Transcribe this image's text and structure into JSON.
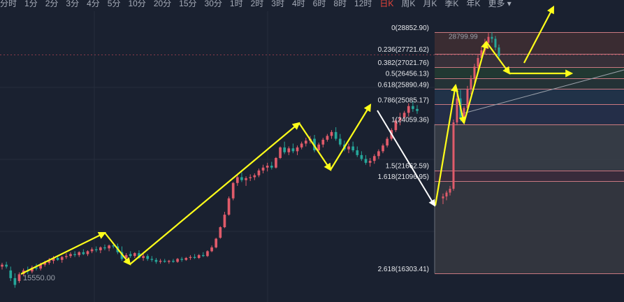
{
  "toolbar": {
    "timeframes": [
      "分时",
      "1分",
      "2分",
      "3分",
      "4分",
      "5分",
      "10分",
      "20分",
      "15分",
      "30分",
      "1时",
      "2时",
      "3时",
      "4时",
      "6时",
      "8时",
      "12时",
      "日K",
      "周K",
      "月K",
      "季K",
      "年K",
      "更多"
    ],
    "active": "日K",
    "colors": {
      "active": "#e8443a",
      "text": "#a6acb8"
    }
  },
  "chart_data": {
    "type": "candlestick",
    "ylim": [
      15100,
      29500
    ],
    "colors": {
      "up": "#e05b6a",
      "down": "#26a69a",
      "arrow": "#ffff1a",
      "arrow_down": "#ffffff"
    },
    "price_labels": [
      {
        "text": "15550.00",
        "value": 15550
      },
      {
        "text": "28799.99",
        "value": 28799.99
      }
    ],
    "fibonacci": [
      {
        "text": "0(28852.90)",
        "ratio": 0,
        "value": 28852.9
      },
      {
        "text": "0.236(27721.62)",
        "ratio": 0.236,
        "value": 27721.62
      },
      {
        "text": "0.382(27021.76)",
        "ratio": 0.382,
        "value": 27021.76
      },
      {
        "text": "0.5(26456.13)",
        "ratio": 0.5,
        "value": 26456.13
      },
      {
        "text": "0.618(25890.49)",
        "ratio": 0.618,
        "value": 25890.49
      },
      {
        "text": "0.786(25085.17)",
        "ratio": 0.786,
        "value": 25085.17
      },
      {
        "text": "1(24059.36)",
        "ratio": 1,
        "value": 24059.36
      },
      {
        "text": "1.5(21662.59)",
        "ratio": 1.5,
        "value": 21662.59
      },
      {
        "text": "1.618(21096.95)",
        "ratio": 1.618,
        "value": 21096.95
      },
      {
        "text": "2.618(16303.41)",
        "ratio": 2.618,
        "value": 16303.41
      }
    ],
    "reference_line": 27700,
    "candles_left": [
      [
        16650,
        16850,
        16500,
        16750
      ],
      [
        16750,
        16900,
        16550,
        16650
      ],
      [
        16450,
        16650,
        15900,
        16050
      ],
      [
        16050,
        16300,
        15550,
        15700
      ],
      [
        15900,
        16350,
        15800,
        16250
      ],
      [
        16250,
        16550,
        16150,
        16450
      ],
      [
        16450,
        16650,
        16250,
        16400
      ],
      [
        16400,
        16700,
        16300,
        16600
      ],
      [
        16600,
        16800,
        16450,
        16550
      ],
      [
        16550,
        16850,
        16450,
        16750
      ],
      [
        16750,
        16950,
        16650,
        16850
      ],
      [
        16850,
        17100,
        16750,
        16950
      ],
      [
        16950,
        17200,
        16800,
        17100
      ],
      [
        17100,
        17250,
        16950,
        17000
      ],
      [
        17000,
        17200,
        16850,
        17150
      ],
      [
        17150,
        17350,
        17050,
        17200
      ],
      [
        17200,
        17400,
        17100,
        17300
      ],
      [
        17300,
        17450,
        17150,
        17250
      ],
      [
        17250,
        17450,
        17150,
        17400
      ],
      [
        17400,
        17550,
        17250,
        17300
      ],
      [
        17300,
        17500,
        17200,
        17450
      ],
      [
        17450,
        17650,
        17350,
        17550
      ],
      [
        17550,
        17700,
        17400,
        17500
      ],
      [
        17500,
        17700,
        17350,
        17650
      ],
      [
        17650,
        17800,
        17500,
        17600
      ],
      [
        17600,
        17800,
        17450,
        17750
      ],
      [
        17750,
        17900,
        17600,
        17700
      ],
      [
        17700,
        17850,
        17300,
        17400
      ],
      [
        17400,
        17700,
        16950,
        17050
      ],
      [
        17100,
        17350,
        16850,
        17250
      ],
      [
        17300,
        17450,
        17100,
        17200
      ],
      [
        17200,
        17400,
        17100,
        17350
      ],
      [
        17350,
        17500,
        17050,
        17100
      ],
      [
        17100,
        17350,
        16950,
        17200
      ],
      [
        17200,
        17300,
        16950,
        17050
      ],
      [
        17050,
        17200,
        16900,
        17000
      ],
      [
        17000,
        17100,
        16800,
        16900
      ],
      [
        16900,
        17050,
        16800,
        16950
      ],
      [
        16950,
        17050,
        16850,
        16900
      ],
      [
        16900,
        17000,
        16800,
        16950
      ],
      [
        16950,
        17050,
        16850,
        16900
      ],
      [
        16900,
        17100,
        16850,
        17050
      ],
      [
        17050,
        17150,
        16900,
        17000
      ],
      [
        17000,
        17150,
        16950,
        17100
      ],
      [
        17100,
        17250,
        17000,
        17150
      ],
      [
        17150,
        17300,
        17050,
        17100
      ],
      [
        17100,
        17300,
        17050,
        17250
      ],
      [
        17250,
        17400,
        17150,
        17200
      ],
      [
        17200,
        17500,
        17150,
        17450
      ],
      [
        17450,
        17750,
        17400,
        17650
      ],
      [
        17650,
        18150,
        17600,
        18100
      ],
      [
        18150,
        18750,
        18100,
        18700
      ],
      [
        18700,
        19500,
        18650,
        19350
      ],
      [
        19350,
        20300,
        19300,
        20200
      ],
      [
        20200,
        21050,
        20100,
        21000
      ],
      [
        21000,
        21450,
        20850,
        21300
      ],
      [
        21300,
        21550,
        21050,
        21150
      ],
      [
        21150,
        21350,
        20850,
        21250
      ],
      [
        21250,
        21450,
        21100,
        21300
      ],
      [
        21300,
        21500,
        21150,
        21400
      ],
      [
        21400,
        21750,
        21300,
        21650
      ],
      [
        21650,
        21950,
        21500,
        21800
      ],
      [
        21800,
        22050,
        21600,
        21900
      ],
      [
        21900,
        22100,
        21700,
        21800
      ],
      [
        21800,
        22350,
        21750,
        22300
      ],
      [
        22300,
        22900,
        22250,
        22850
      ],
      [
        22850,
        23150,
        22500,
        22600
      ],
      [
        22600,
        22900,
        22450,
        22800
      ],
      [
        22800,
        23050,
        22550,
        22650
      ],
      [
        22650,
        22950,
        22450,
        22850
      ],
      [
        22850,
        23150,
        22750,
        23050
      ],
      [
        23050,
        23350,
        22900,
        23200
      ],
      [
        23200,
        23450,
        23050,
        23300
      ],
      [
        23300,
        23500,
        22600,
        22700
      ],
      [
        22700,
        23100,
        22600,
        23000
      ],
      [
        23000,
        23350,
        22850,
        23250
      ],
      [
        23250,
        23550,
        23150,
        23450
      ],
      [
        23450,
        23750,
        23300,
        23650
      ],
      [
        23650,
        23900,
        23200,
        23300
      ],
      [
        23300,
        23550,
        22900,
        23000
      ],
      [
        23000,
        23200,
        22650,
        22750
      ],
      [
        22750,
        23050,
        22550,
        22900
      ],
      [
        22900,
        23150,
        22600,
        22700
      ],
      [
        22700,
        22900,
        22350,
        22450
      ],
      [
        22450,
        22650,
        22150,
        22250
      ],
      [
        22250,
        22450,
        21950,
        22050
      ],
      [
        22050,
        22300,
        21850,
        22150
      ],
      [
        22150,
        22500,
        22000,
        22400
      ],
      [
        22400,
        22750,
        22250,
        22650
      ],
      [
        22650,
        23050,
        22550,
        22950
      ],
      [
        22950,
        23400,
        22850,
        23300
      ],
      [
        23300,
        23850,
        23200,
        23750
      ],
      [
        23750,
        24350,
        23650,
        24250
      ],
      [
        24250,
        24650,
        24000,
        24400
      ],
      [
        24400,
        24750,
        24200,
        24650
      ],
      [
        24650,
        25150,
        24450,
        25000
      ],
      [
        25000,
        25250,
        24700,
        24850
      ],
      [
        24850,
        25050,
        24600,
        24750
      ]
    ],
    "candles_right": [
      [
        20200,
        20450,
        19900,
        20300
      ],
      [
        20300,
        20600,
        20100,
        20500
      ],
      [
        20500,
        20850,
        20350,
        20700
      ],
      [
        20700,
        24300,
        20600,
        24150
      ],
      [
        24150,
        25800,
        24000,
        25400
      ],
      [
        25400,
        25850,
        24200,
        24400
      ],
      [
        24400,
        25000,
        24200,
        24900
      ],
      [
        24900,
        26050,
        24800,
        25900
      ],
      [
        25900,
        26600,
        25600,
        26400
      ],
      [
        26400,
        27200,
        26200,
        27050
      ],
      [
        27050,
        27700,
        26800,
        27500
      ],
      [
        27500,
        28100,
        27300,
        27900
      ],
      [
        27900,
        28500,
        27700,
        28300
      ],
      [
        28300,
        28800,
        28000,
        28600
      ],
      [
        28600,
        28850,
        28300,
        28500
      ],
      [
        28500,
        28650,
        27900,
        28050
      ],
      [
        28050,
        28200,
        27500,
        27600
      ]
    ],
    "bands": [
      {
        "from": 28852.9,
        "to": 27721.62,
        "color": "#3c2d33"
      },
      {
        "from": 27721.62,
        "to": 27021.76,
        "color": "#39323a"
      },
      {
        "from": 27021.76,
        "to": 26456.13,
        "color": "#233a33"
      },
      {
        "from": 26456.13,
        "to": 25890.49,
        "color": "#253437"
      },
      {
        "from": 25890.49,
        "to": 25085.17,
        "color": "#22344a"
      },
      {
        "from": 25085.17,
        "to": 24059.36,
        "color": "#252f4a"
      },
      {
        "from": 24059.36,
        "to": 21662.59,
        "color": "#373d47"
      },
      {
        "from": 21662.59,
        "to": 21096.95,
        "color": "#3a2c3c"
      },
      {
        "from": 21096.95,
        "to": 16303.41,
        "color": "#34373f"
      }
    ],
    "band_lines": {
      "from": 24059.36,
      "to": 16303.41,
      "color": "#6a6f7a"
    }
  }
}
